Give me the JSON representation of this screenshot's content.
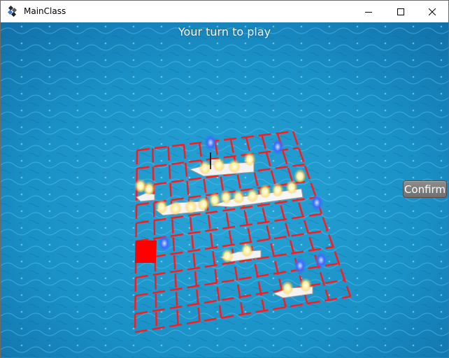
{
  "window": {
    "title": "MainClass",
    "controls": [
      "minimize-icon",
      "maximize-icon",
      "close-icon"
    ]
  },
  "game": {
    "status": "Your turn to play",
    "confirm_label": "Confirm",
    "grid_color": "#ff1a1a",
    "selected_cell_color": "#ff0000",
    "water_color": "#1b8fc4"
  }
}
